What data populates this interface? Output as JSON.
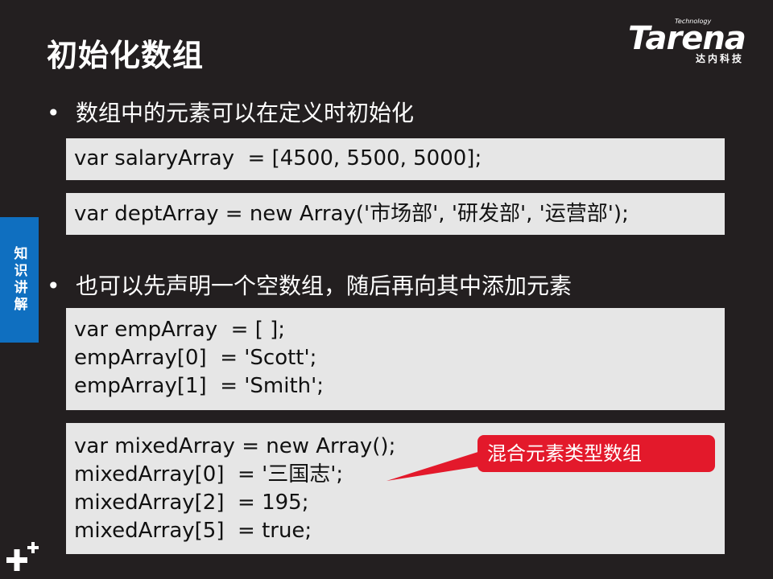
{
  "slide": {
    "title": "初始化数组"
  },
  "logo": {
    "tech": "Technology",
    "word": "Tarena",
    "subtitle": "达内科技"
  },
  "side_tab": {
    "label": "知识讲解"
  },
  "bullets": [
    {
      "marker": "•",
      "text": "数组中的元素可以在定义时初始化"
    },
    {
      "marker": "•",
      "text": "也可以先声明一个空数组，随后再向其中添加元素"
    }
  ],
  "code_blocks": [
    {
      "lines": [
        "var salaryArray  = [4500, 5500, 5000];"
      ]
    },
    {
      "lines": [
        "var deptArray = new Array('市场部', '研发部', '运营部');"
      ]
    },
    {
      "lines": [
        "var empArray  = [ ];",
        "empArray[0]  = 'Scott';",
        "empArray[1]  = 'Smith';"
      ]
    },
    {
      "lines": [
        "var mixedArray = new Array();",
        "mixedArray[0]  = '三国志';",
        "mixedArray[2]  = 195;",
        "mixedArray[5]  = true;"
      ]
    }
  ],
  "callout": {
    "text": "混合元素类型数组",
    "color": "#e3192b"
  },
  "colors": {
    "background": "#231f20",
    "code_bg": "#e6e6e6",
    "side_tab": "#0f6fc0"
  }
}
